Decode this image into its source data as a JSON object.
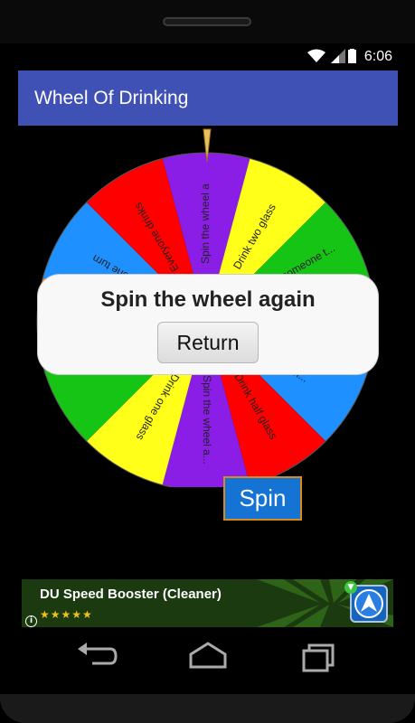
{
  "status_bar": {
    "time": "6:06"
  },
  "app_bar": {
    "title": "Wheel Of Drinking"
  },
  "wheel": {
    "segments": [
      {
        "label": "Spin the wheel a",
        "color": "#8a1ee6"
      },
      {
        "label": "Drink two glass",
        "color": "#ffff1a"
      },
      {
        "label": "Choose someone t...",
        "color": "#16c416"
      },
      {
        "label": "",
        "color": "#ff8000"
      },
      {
        "label": "...r dri...",
        "color": "#1e90ff"
      },
      {
        "label": "Drink half glass",
        "color": "#ff0000"
      },
      {
        "label": "Spin the wheel a...",
        "color": "#8a1ee6"
      },
      {
        "label": "Drink one glass",
        "color": "#ffff1a"
      },
      {
        "label": "",
        "color": "#16c416"
      },
      {
        "label": "",
        "color": "#ff8000"
      },
      {
        "label": "Skip one turn",
        "color": "#1e90ff"
      },
      {
        "label": "Everyone drinks",
        "color": "#ff0000"
      }
    ]
  },
  "dialog": {
    "message": "Spin the wheel again",
    "button_label": "Return"
  },
  "spin_button": {
    "label": "Spin"
  },
  "ad": {
    "title": "DU Speed Booster (Cleaner)",
    "rating": 4.5,
    "stars": "★★★★★",
    "info": "i"
  },
  "nav": {
    "back": "back-icon",
    "home": "home-icon",
    "recents": "recents-icon"
  },
  "colors": {
    "app_bar": "#3f51b5",
    "spin_button": "#1573d4"
  }
}
